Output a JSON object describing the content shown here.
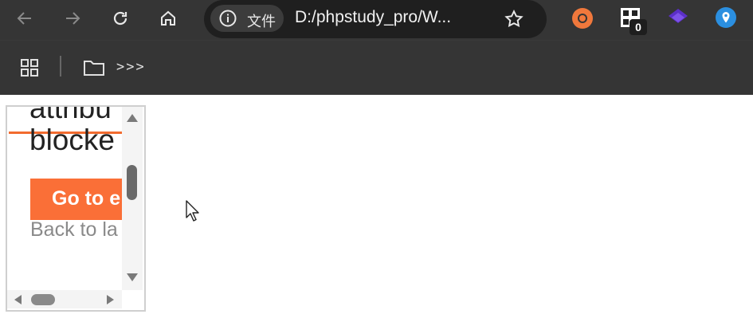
{
  "browser": {
    "nav": {
      "back_icon": "arrow-left-icon",
      "forward_icon": "arrow-right-icon",
      "reload_icon": "reload-icon",
      "home_icon": "home-icon"
    },
    "omnibox": {
      "security_chip_label": "文件",
      "url": "D:/phpstudy_pro/W...",
      "info_icon": "info-icon",
      "bookmark_icon": "star-icon"
    },
    "extensions": [
      {
        "name": "orange-ring-extension-icon",
        "color": "#f0783c"
      },
      {
        "name": "qr-extension-icon",
        "badge": "0"
      },
      {
        "name": "purple-layers-extension-icon",
        "color": "#5b2fc7"
      },
      {
        "name": "map-pin-extension-icon",
        "color": "#2b8fe0"
      }
    ],
    "bookmarks_bar": {
      "apps_icon": "apps-grid-icon",
      "folder_icon": "folder-icon",
      "folder_label": ">>>"
    }
  },
  "iframe": {
    "heading_line1": "attribu",
    "heading_line2": "blocke",
    "button_label": "Go to e",
    "back_link": "Back to la",
    "accent_color": "#fa6f37"
  }
}
